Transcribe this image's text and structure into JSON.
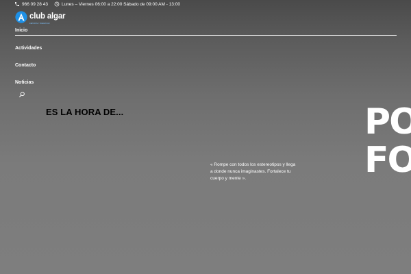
{
  "topbar": {
    "phone": "966 09 28 43",
    "hours": "Lunes – Viernes 06:00 a 22:00 Sábado de 09:00 AM - 13:00",
    "phone_icon": "phone-icon",
    "clock_icon": "clock-icon"
  },
  "logo": {
    "brand": "club algar",
    "tagline": "DEPORTE Y BIENESTAR",
    "accent": "#1e90e6"
  },
  "nav": {
    "items": [
      {
        "label": "Inicio",
        "active": true
      },
      {
        "label": "Actividades"
      },
      {
        "label": "Contacto"
      },
      {
        "label": "Noticias"
      }
    ],
    "search_icon": "search-icon"
  },
  "hero": {
    "title": "ES LA HORA DE...",
    "quote": "« Rompe con todos los estereotipos y llega a donde nunca imaginastes. Fortalece tu cuerpo y mente ».",
    "big_line_1": "PO",
    "big_line_2": "FO"
  }
}
